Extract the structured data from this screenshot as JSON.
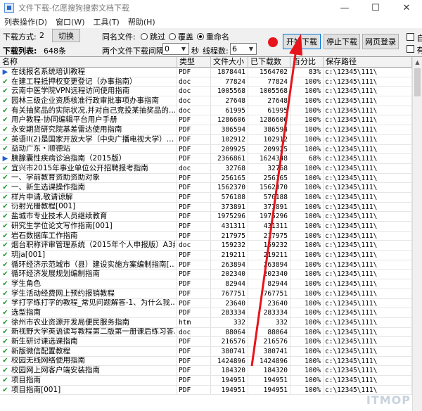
{
  "window": {
    "title": "文件下载-亿愿搜狗搜索文档下载",
    "controls": {
      "minimize": "—",
      "maximize": "☐",
      "close": "✕"
    }
  },
  "menu": [
    "列表操作(D)",
    "窗口(W)",
    "工具(T)",
    "帮助(H)"
  ],
  "toolbar": {
    "mode_label": "下载方式:",
    "mode_value": "2",
    "switch_button": "切换",
    "list_label": "下载列表:",
    "list_count": "648条",
    "same_name_label": "同名文件:",
    "opt_skip": "跳过",
    "opt_overwrite": "覆盖",
    "opt_rename": "重命名",
    "selected_option": "rename",
    "interval_label": "两个文件下载间隔:",
    "interval_value": "0",
    "seconds_label": "秒",
    "threads_label": "线程数:",
    "threads_value": "6",
    "start_button": "开始下载",
    "stop_button": "停止下载",
    "login_button": "网页登录",
    "check1_label": "自",
    "check2_label": "有"
  },
  "accent_colors": {
    "record": "#e8141c",
    "done": "#1e9a2e",
    "playing": "#1f5fd1",
    "annotation_arrow": "#e8141c"
  },
  "table": {
    "columns": [
      "名称",
      "类型",
      "文件大小",
      "已下载数",
      "百分比",
      "保存路径"
    ],
    "rows": [
      {
        "status": "play",
        "name": "在线报名系统培训教程",
        "type": "PDF",
        "size": "1878441",
        "downloaded": "1564702",
        "pct": "83%",
        "path": "c:\\12345\\111\\"
      },
      {
        "status": "done",
        "name": "在建工程抵押权变更登记（办事指南）",
        "type": "doc",
        "size": "77824",
        "downloaded": "77824",
        "pct": "100%",
        "path": "c:\\12345\\111\\"
      },
      {
        "status": "done",
        "name": "云南中医学院VPN远程访问使用指南",
        "type": "doc",
        "size": "1005568",
        "downloaded": "1005568",
        "pct": "100%",
        "path": "c:\\12345\\111\\"
      },
      {
        "status": "done",
        "name": "园林三级企业资质核准行政审批事项办事指南",
        "type": "doc",
        "size": "27648",
        "downloaded": "27648",
        "pct": "100%",
        "path": "c:\\12345\\111\\"
      },
      {
        "status": "done",
        "name": "有关抽奖品的实际状况,并对自己竞投某抽奖品的…",
        "type": "doc",
        "size": "61995",
        "downloaded": "61995",
        "pct": "100%",
        "path": "c:\\12345\\111\\"
      },
      {
        "status": "done",
        "name": "用户教程-协同编辑平台用户手册",
        "type": "PDF",
        "size": "1286606",
        "downloaded": "1286606",
        "pct": "100%",
        "path": "c:\\12345\\111\\"
      },
      {
        "status": "done",
        "name": "永安期货研究院基差雷达使用指南",
        "type": "PDF",
        "size": "386594",
        "downloaded": "386594",
        "pct": "100%",
        "path": "c:\\12345\\111\\"
      },
      {
        "status": "done",
        "name": "英语II(2)是国家开放大学（中央广播电视大学）…",
        "type": "PDF",
        "size": "102912",
        "downloaded": "102912",
        "pct": "100%",
        "path": "c:\\12345\\111\\"
      },
      {
        "status": "done",
        "name": "益动广东・顺德站",
        "type": "PDF",
        "size": "209925",
        "downloaded": "209925",
        "pct": "100%",
        "path": "c:\\12345\\111\\"
      },
      {
        "status": "play",
        "name": "胰腺囊性疾病诊治指南（2015版）",
        "type": "PDF",
        "size": "2366861",
        "downloaded": "1624348",
        "pct": "68%",
        "path": "c:\\12345\\111\\"
      },
      {
        "status": "done",
        "name": "宜兴市2015年事业单位公开招聘报考指南",
        "type": "doc",
        "size": "32768",
        "downloaded": "32768",
        "pct": "100%",
        "path": "c:\\12345\\111\\"
      },
      {
        "status": "done",
        "name": "一、学前教育资助资助对象",
        "type": "PDF",
        "size": "256165",
        "downloaded": "256165",
        "pct": "100%",
        "path": "c:\\12345\\111\\"
      },
      {
        "status": "done",
        "name": "一、新生选课操作指南",
        "type": "PDF",
        "size": "1562370",
        "downloaded": "1562370",
        "pct": "100%",
        "path": "c:\\12345\\111\\"
      },
      {
        "status": "done",
        "name": "样片申请,敬请谅解",
        "type": "PDF",
        "size": "576188",
        "downloaded": "576188",
        "pct": "100%",
        "path": "c:\\12345\\111\\"
      },
      {
        "status": "done",
        "name": "衍射光栅教程[001]",
        "type": "PDF",
        "size": "373891",
        "downloaded": "373891",
        "pct": "100%",
        "path": "c:\\12345\\111\\"
      },
      {
        "status": "done",
        "name": "盐城市专业技术人员继续教育",
        "type": "PDF",
        "size": "1975296",
        "downloaded": "1975296",
        "pct": "100%",
        "path": "c:\\12345\\111\\"
      },
      {
        "status": "done",
        "name": "研究生学位论文写作指南[001]",
        "type": "PDF",
        "size": "431311",
        "downloaded": "431311",
        "pct": "100%",
        "path": "c:\\12345\\111\\"
      },
      {
        "status": "done",
        "name": "岩石数据库工作指南",
        "type": "PDF",
        "size": "217975",
        "downloaded": "217975",
        "pct": "100%",
        "path": "c:\\12345\\111\\"
      },
      {
        "status": "done",
        "name": "烟台职称评审管理系统（2015年个人申报版）A3纸…",
        "type": "doc",
        "size": "159232",
        "downloaded": "159232",
        "pct": "100%",
        "path": "c:\\12345\\111\\"
      },
      {
        "status": "done",
        "name": "玥ja[001]",
        "type": "PDF",
        "size": "219211",
        "downloaded": "219211",
        "pct": "100%",
        "path": "c:\\12345\\111\\"
      },
      {
        "status": "done",
        "name": "循环经济示范城市（县）建设实施方案编制指南[…",
        "type": "PDF",
        "size": "263894",
        "downloaded": "263894",
        "pct": "100%",
        "path": "c:\\12345\\111\\"
      },
      {
        "status": "done",
        "name": "循环经济发展规划编制指南",
        "type": "PDF",
        "size": "202340",
        "downloaded": "202340",
        "pct": "100%",
        "path": "c:\\12345\\111\\"
      },
      {
        "status": "done",
        "name": "学生角色",
        "type": "PDF",
        "size": "82944",
        "downloaded": "82944",
        "pct": "100%",
        "path": "c:\\12345\\111\\"
      },
      {
        "status": "done",
        "name": "学生活动经费网上预约报销教程",
        "type": "PDF",
        "size": "767751",
        "downloaded": "767751",
        "pct": "100%",
        "path": "c:\\12345\\111\\"
      },
      {
        "status": "done",
        "name": "学打字练打字的教程_常见问题解答-1、为什么我…",
        "type": "PDF",
        "size": "23640",
        "downloaded": "23640",
        "pct": "100%",
        "path": "c:\\12345\\111\\"
      },
      {
        "status": "done",
        "name": "选型指南",
        "type": "PDF",
        "size": "283334",
        "downloaded": "283334",
        "pct": "100%",
        "path": "c:\\12345\\111\\"
      },
      {
        "status": "done",
        "name": "徐州市农业资源开发局便民服务指南",
        "type": "htm",
        "size": "332",
        "downloaded": "332",
        "pct": "100%",
        "path": "c:\\12345\\111\\"
      },
      {
        "status": "done",
        "name": "新视野大学英语读写教程第二版第一册课后练习答…",
        "type": "doc",
        "size": "88064",
        "downloaded": "88064",
        "pct": "100%",
        "path": "c:\\12345\\111\\"
      },
      {
        "status": "done",
        "name": "新生研讨课选课指南",
        "type": "PDF",
        "size": "216576",
        "downloaded": "216576",
        "pct": "100%",
        "path": "c:\\12345\\111\\"
      },
      {
        "status": "done",
        "name": "新版微信配置教程",
        "type": "PDF",
        "size": "380741",
        "downloaded": "380741",
        "pct": "100%",
        "path": "c:\\12345\\111\\"
      },
      {
        "status": "done",
        "name": "校园无线网络使用指南",
        "type": "PDF",
        "size": "1424896",
        "downloaded": "1424896",
        "pct": "100%",
        "path": "c:\\12345\\111\\"
      },
      {
        "status": "done",
        "name": "校园网上网客户端安装指南",
        "type": "PDF",
        "size": "184320",
        "downloaded": "184320",
        "pct": "100%",
        "path": "c:\\12345\\111\\"
      },
      {
        "status": "done",
        "name": "项目指南",
        "type": "PDF",
        "size": "194951",
        "downloaded": "194951",
        "pct": "100%",
        "path": "c:\\12345\\111\\"
      },
      {
        "status": "done",
        "name": "项目指南[001]",
        "type": "PDF",
        "size": "194951",
        "downloaded": "194951",
        "pct": "100%",
        "path": "c:\\12345\\111\\"
      }
    ]
  },
  "watermark": "ITMOP"
}
